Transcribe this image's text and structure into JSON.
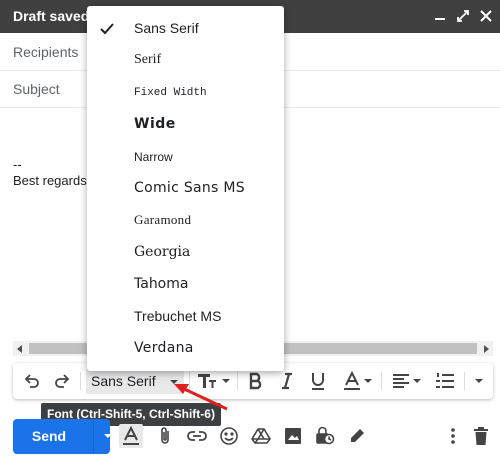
{
  "window": {
    "title": "Draft saved"
  },
  "fields": {
    "recipients": "Recipients",
    "subject": "Subject"
  },
  "body": {
    "line1": "--",
    "line2": "Best regards"
  },
  "font_menu": {
    "selected": "Sans Serif",
    "options": [
      "Sans Serif",
      "Serif",
      "Fixed Width",
      "Wide",
      "Narrow",
      "Comic Sans MS",
      "Garamond",
      "Georgia",
      "Tahoma",
      "Trebuchet MS",
      "Verdana"
    ]
  },
  "toolbar": {
    "font_value": "Sans Serif"
  },
  "tooltip": {
    "text": "Font (Ctrl-Shift-5, Ctrl-Shift-6)"
  },
  "send": {
    "label": "Send"
  },
  "colors": {
    "send": "#1a73e8",
    "titlebar": "#404040",
    "annotation_arrow": "#e02020",
    "tooltip_bg": "#3c4043"
  }
}
